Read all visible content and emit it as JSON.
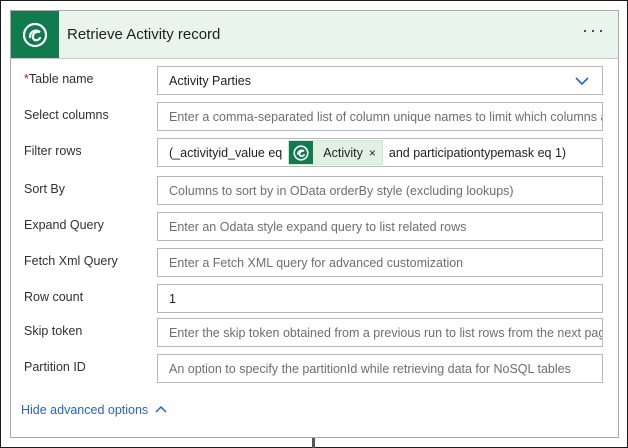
{
  "header": {
    "title": "Retrieve Activity record",
    "more_label": "···",
    "icon": "dataverse-icon",
    "accent_color": "#0f7b4f"
  },
  "fields": {
    "table_name": {
      "required_mark": "*",
      "label": "Table name",
      "value": "Activity Parties"
    },
    "select_columns": {
      "label": "Select columns",
      "placeholder": "Enter a comma-separated list of column unique names to limit which columns are listed"
    },
    "filter_rows": {
      "label": "Filter rows",
      "prefix": "(_activityid_value eq",
      "token_label": "Activity",
      "token_remove": "×",
      "suffix": "and participationtypemask eq 1)"
    },
    "sort_by": {
      "label": "Sort By",
      "placeholder": "Columns to sort by in OData orderBy style (excluding lookups)"
    },
    "expand_query": {
      "label": "Expand Query",
      "placeholder": "Enter an Odata style expand query to list related rows"
    },
    "fetch_xml": {
      "label": "Fetch Xml Query",
      "placeholder": "Enter a Fetch XML query for advanced customization"
    },
    "row_count": {
      "label": "Row count",
      "value": "1"
    },
    "skip_token": {
      "label": "Skip token",
      "placeholder": "Enter the skip token obtained from a previous run to list rows from the next page"
    },
    "partition_id": {
      "label": "Partition ID",
      "placeholder": "An option to specify the partitionId while retrieving data for NoSQL tables"
    }
  },
  "footer": {
    "hide_advanced": "Hide advanced options"
  }
}
